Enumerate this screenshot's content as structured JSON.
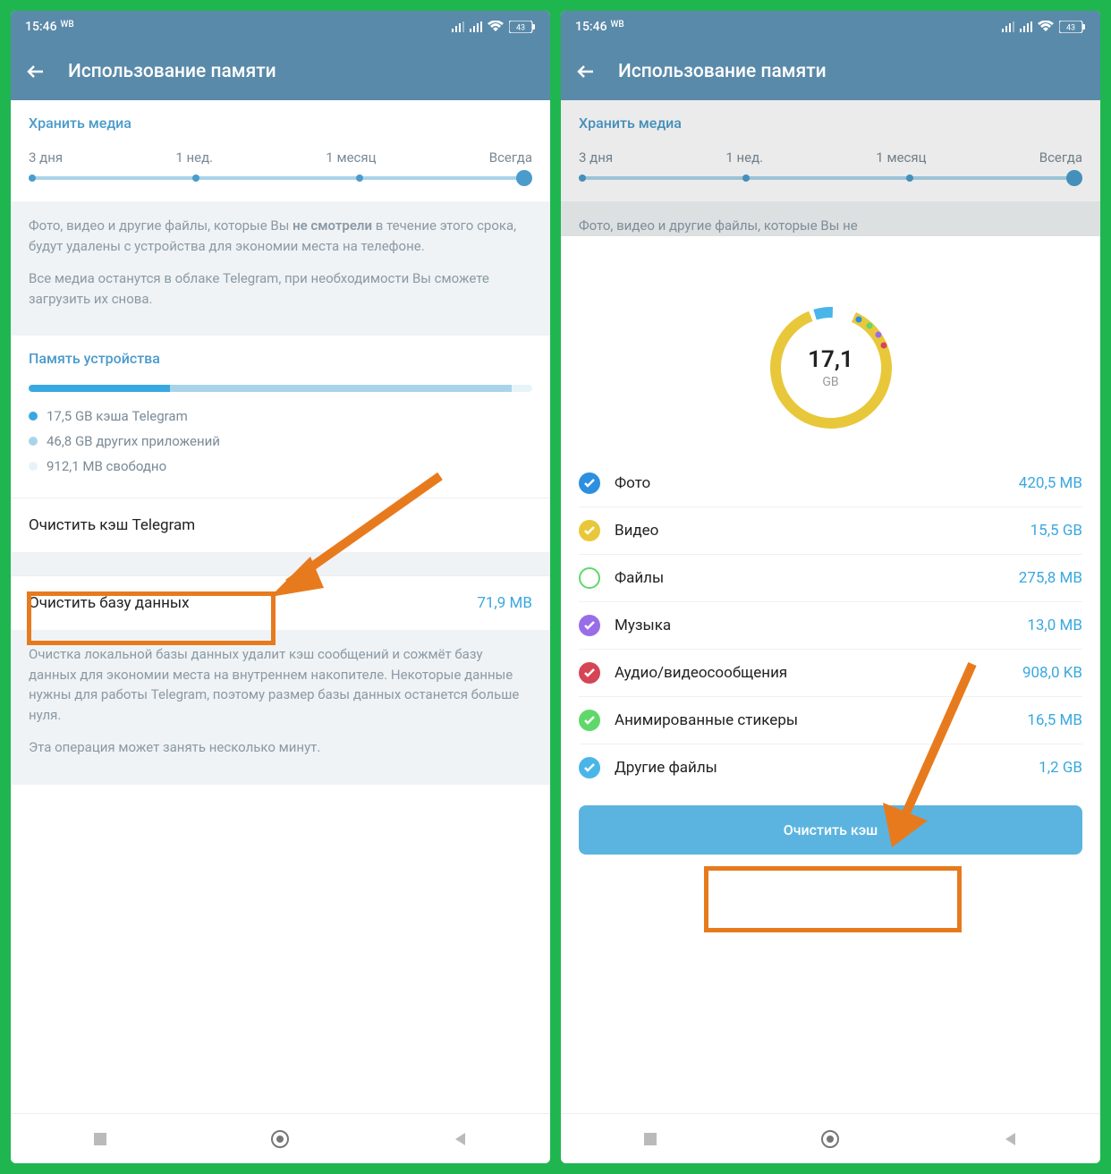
{
  "status": {
    "time": "15:46",
    "wb": "WB",
    "battery": "43"
  },
  "header": {
    "title": "Использование памяти"
  },
  "slider": {
    "title": "Хранить медиа",
    "labels": [
      "3 дня",
      "1 нед.",
      "1 месяц",
      "Всегда"
    ]
  },
  "info": {
    "p1a": "Фото, видео и другие файлы, которые Вы ",
    "p1b": "не смотрели",
    "p1c": " в течение этого срока, будут удалены с устройства для экономии места на телефоне.",
    "p2": "Все медиа останутся в облаке Telegram, при необходимости Вы сможете загрузить их снова."
  },
  "storage": {
    "title": "Память устройства",
    "legend": [
      {
        "color": "#3aa8e0",
        "text": "17,5 GB кэша Telegram"
      },
      {
        "color": "#a8d4ea",
        "text": "46,8 GB других приложений"
      },
      {
        "color": "#e8f3f9",
        "text": "912,1 MB свободно"
      }
    ]
  },
  "actions": {
    "clear_cache": "Очистить кэш Telegram",
    "clear_db": "Очистить базу данных",
    "db_size": "71,9 MB"
  },
  "db_info": {
    "p1": "Очистка локальной базы данных удалит кэш сообщений и сожмёт базу данных для экономии места на внутреннем накопителе. Некоторые данные нужны для работы Telegram, поэтому размер базы данных останется больше нуля.",
    "p2": "Эта операция может занять несколько минут."
  },
  "sheet": {
    "total_value": "17,1",
    "total_unit": "GB",
    "categories": [
      {
        "color": "#2d8fe0",
        "label": "Фото",
        "size": "420,5 MB",
        "checked": true
      },
      {
        "color": "#e8c83a",
        "label": "Видео",
        "size": "15,5 GB",
        "checked": true
      },
      {
        "color": "#5fd86a",
        "label": "Файлы",
        "size": "275,8 MB",
        "checked": false,
        "hollow": true
      },
      {
        "color": "#9a6de8",
        "label": "Музыка",
        "size": "13,0 MB",
        "checked": true
      },
      {
        "color": "#d64555",
        "label": "Аудио/видеосообщения",
        "size": "908,0 KB",
        "checked": true
      },
      {
        "color": "#5fd86a",
        "label": "Анимированные стикеры",
        "size": "16,5 MB",
        "checked": true
      },
      {
        "color": "#4ab5e8",
        "label": "Другие файлы",
        "size": "1,2 GB",
        "checked": true
      }
    ],
    "button": "Очистить кэш"
  },
  "right_info_cut": "Фото, видео и другие файлы, которые Вы не"
}
